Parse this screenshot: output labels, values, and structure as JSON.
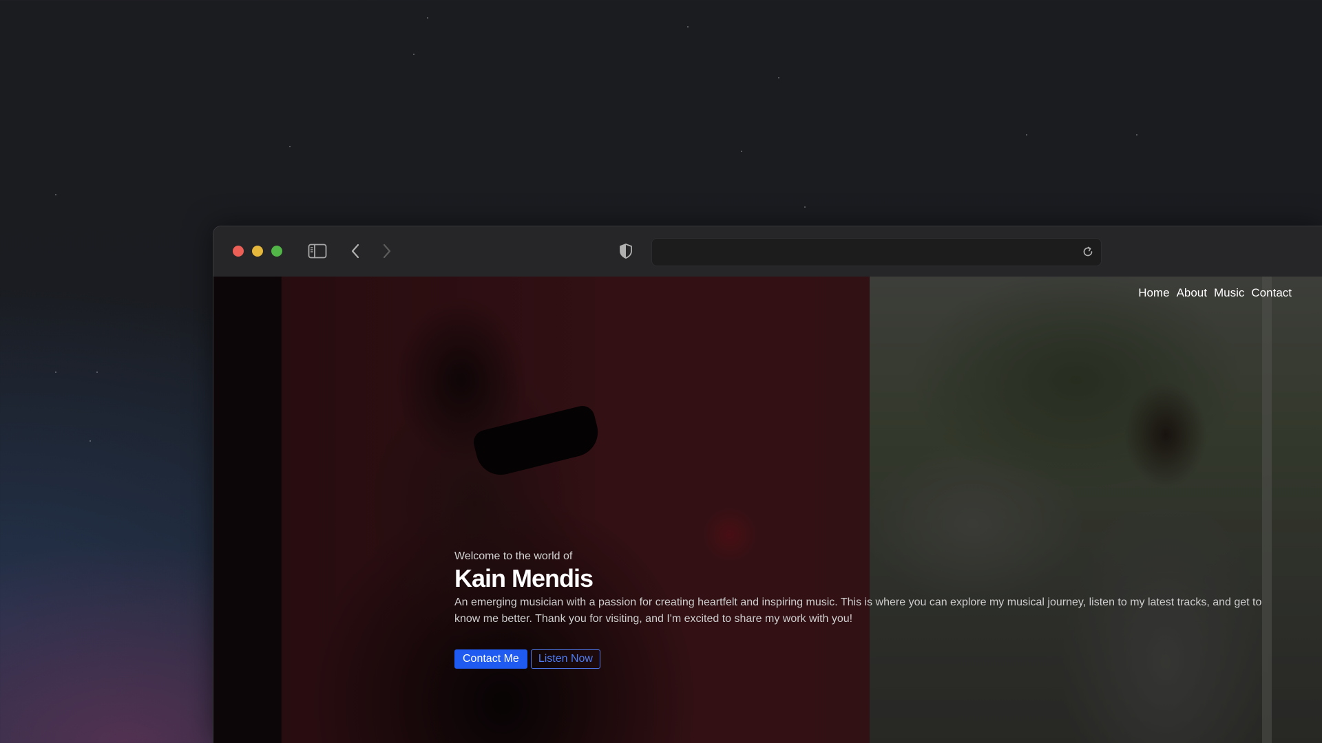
{
  "browser": {
    "url": "",
    "toolbar": {
      "sidebar_icon": "sidebar-icon",
      "back_icon": "chevron-left-icon",
      "forward_icon": "chevron-right-icon",
      "privacy_icon": "shield-icon",
      "reload_icon": "reload-icon"
    }
  },
  "nav": {
    "items": [
      {
        "label": "Home"
      },
      {
        "label": "About"
      },
      {
        "label": "Music"
      },
      {
        "label": "Contact"
      }
    ]
  },
  "hero": {
    "eyebrow": "Welcome to the world of",
    "name": "Kain Mendis",
    "description": "An emerging musician with a passion for creating heartfelt and inspiring music. This is where you can explore my musical journey, listen to my latest tracks, and get to know me better. Thank you for visiting, and I'm excited to share my work with you!",
    "primary_button": "Contact Me",
    "secondary_button": "Listen Now"
  },
  "colors": {
    "accent": "#1f5bf0",
    "traffic_red": "#ec5f57",
    "traffic_yellow": "#e4b63b",
    "traffic_green": "#52b548"
  }
}
